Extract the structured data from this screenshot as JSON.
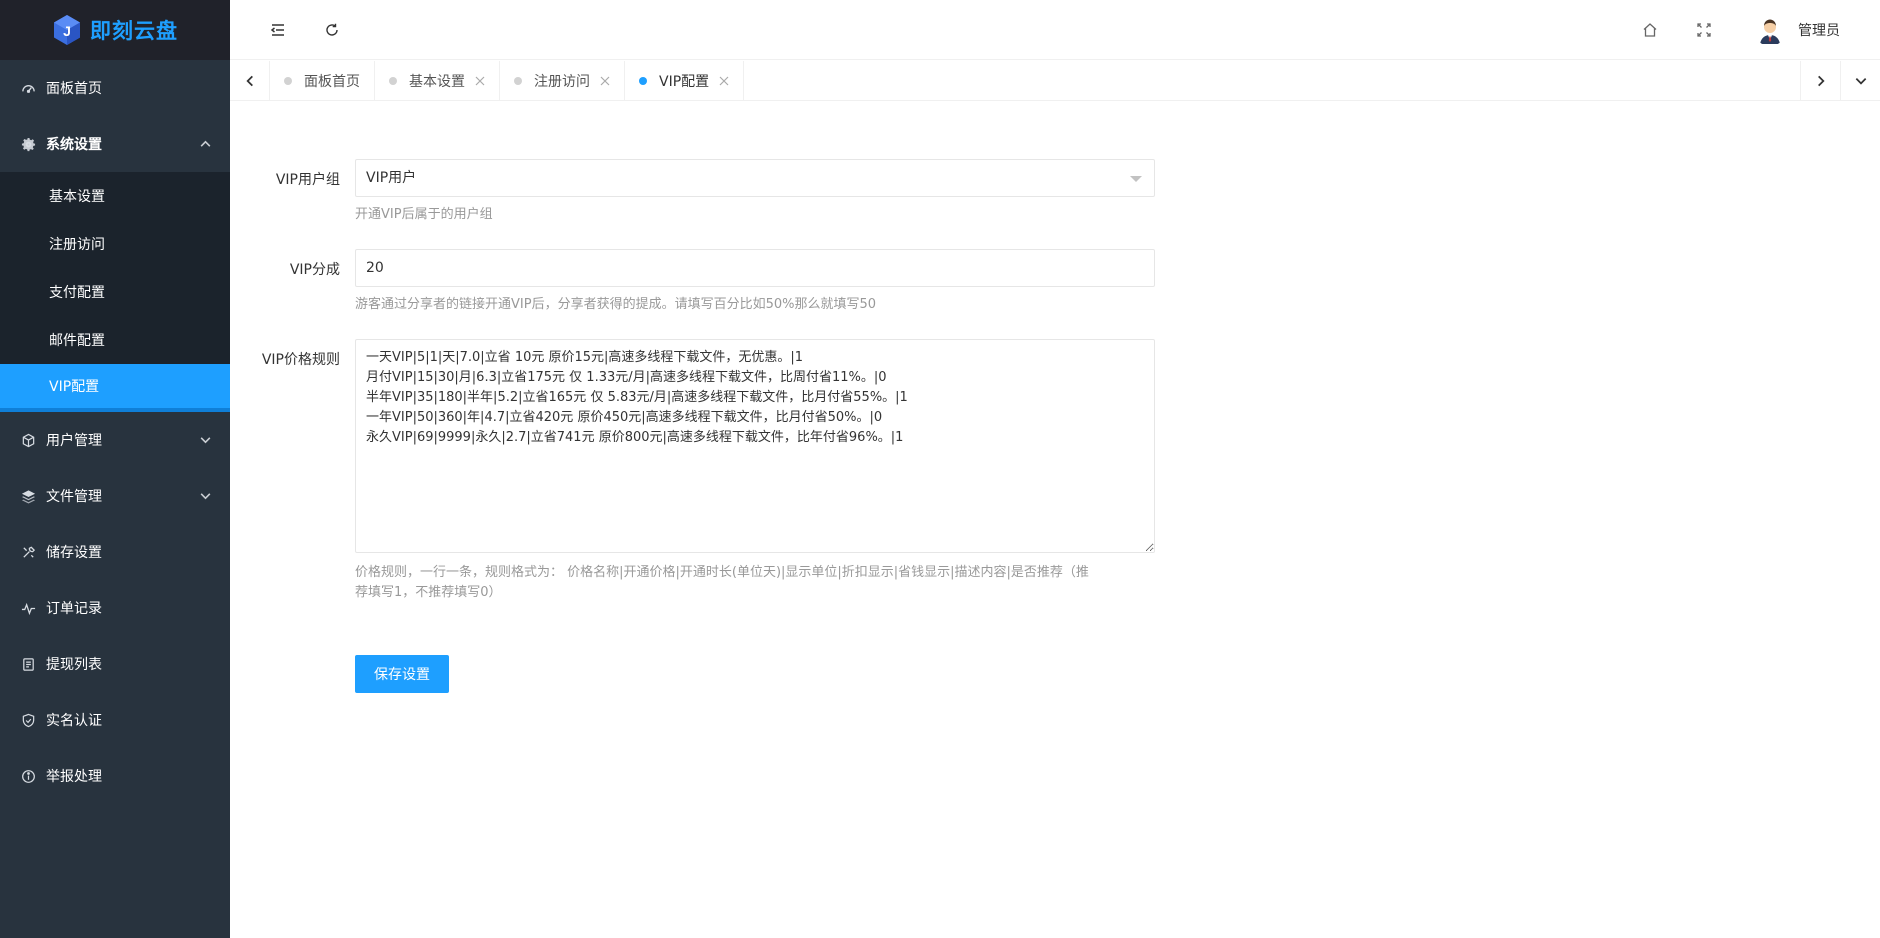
{
  "brand": {
    "name": "即刻云盘",
    "accent": "#1E9FFF",
    "sidebar_bg": "#28333e"
  },
  "sidebar": {
    "items": [
      {
        "label": "面板首页",
        "icon": "dashboard-icon"
      },
      {
        "label": "系统设置",
        "icon": "gear-icon",
        "expanded": true,
        "children": [
          {
            "label": "基本设置"
          },
          {
            "label": "注册访问"
          },
          {
            "label": "支付配置"
          },
          {
            "label": "邮件配置"
          },
          {
            "label": "VIP配置",
            "active": true
          }
        ]
      },
      {
        "label": "用户管理",
        "icon": "cube-icon",
        "expandable": true
      },
      {
        "label": "文件管理",
        "icon": "layers-icon",
        "expandable": true
      },
      {
        "label": "储存设置",
        "icon": "tools-icon"
      },
      {
        "label": "订单记录",
        "icon": "pulse-icon"
      },
      {
        "label": "提现列表",
        "icon": "list-doc-icon"
      },
      {
        "label": "实名认证",
        "icon": "shield-check-icon"
      },
      {
        "label": "举报处理",
        "icon": "info-circle-icon"
      }
    ]
  },
  "header": {
    "user_name": "管理员"
  },
  "tabs": [
    {
      "label": "面板首页",
      "closable": false,
      "active": false
    },
    {
      "label": "基本设置",
      "closable": true,
      "active": false
    },
    {
      "label": "注册访问",
      "closable": true,
      "active": false
    },
    {
      "label": "VIP配置",
      "closable": true,
      "active": true
    }
  ],
  "form": {
    "vip_group": {
      "label": "VIP用户组",
      "value": "VIP用户",
      "hint": "开通VIP后属于的用户组"
    },
    "vip_share": {
      "label": "VIP分成",
      "value": "20",
      "hint": "游客通过分享者的链接开通VIP后，分享者获得的提成。请填写百分比如50%那么就填写50"
    },
    "vip_rules": {
      "label": "VIP价格规则",
      "value": "一天VIP|5|1|天|7.0|立省 10元 原价15元|高速多线程下载文件，无优惠。|1\n月付VIP|15|30|月|6.3|立省175元 仅 1.33元/月|高速多线程下载文件，比周付省11%。|0\n半年VIP|35|180|半年|5.2|立省165元 仅 5.83元/月|高速多线程下载文件，比月付省55%。|1\n一年VIP|50|360|年|4.7|立省420元 原价450元|高速多线程下载文件，比月付省50%。|0\n永久VIP|69|9999|永久|2.7|立省741元 原价800元|高速多线程下载文件，比年付省96%。|1",
      "hint_line1": "价格规则，一行一条，规则格式为： 价格名称|开通价格|开通时长(单位天)|显示单位|折扣显示|省钱显示|描述内容|是否推荐（推",
      "hint_line2": "荐填写1，不推荐填写0）"
    },
    "save_label": "保存设置"
  }
}
